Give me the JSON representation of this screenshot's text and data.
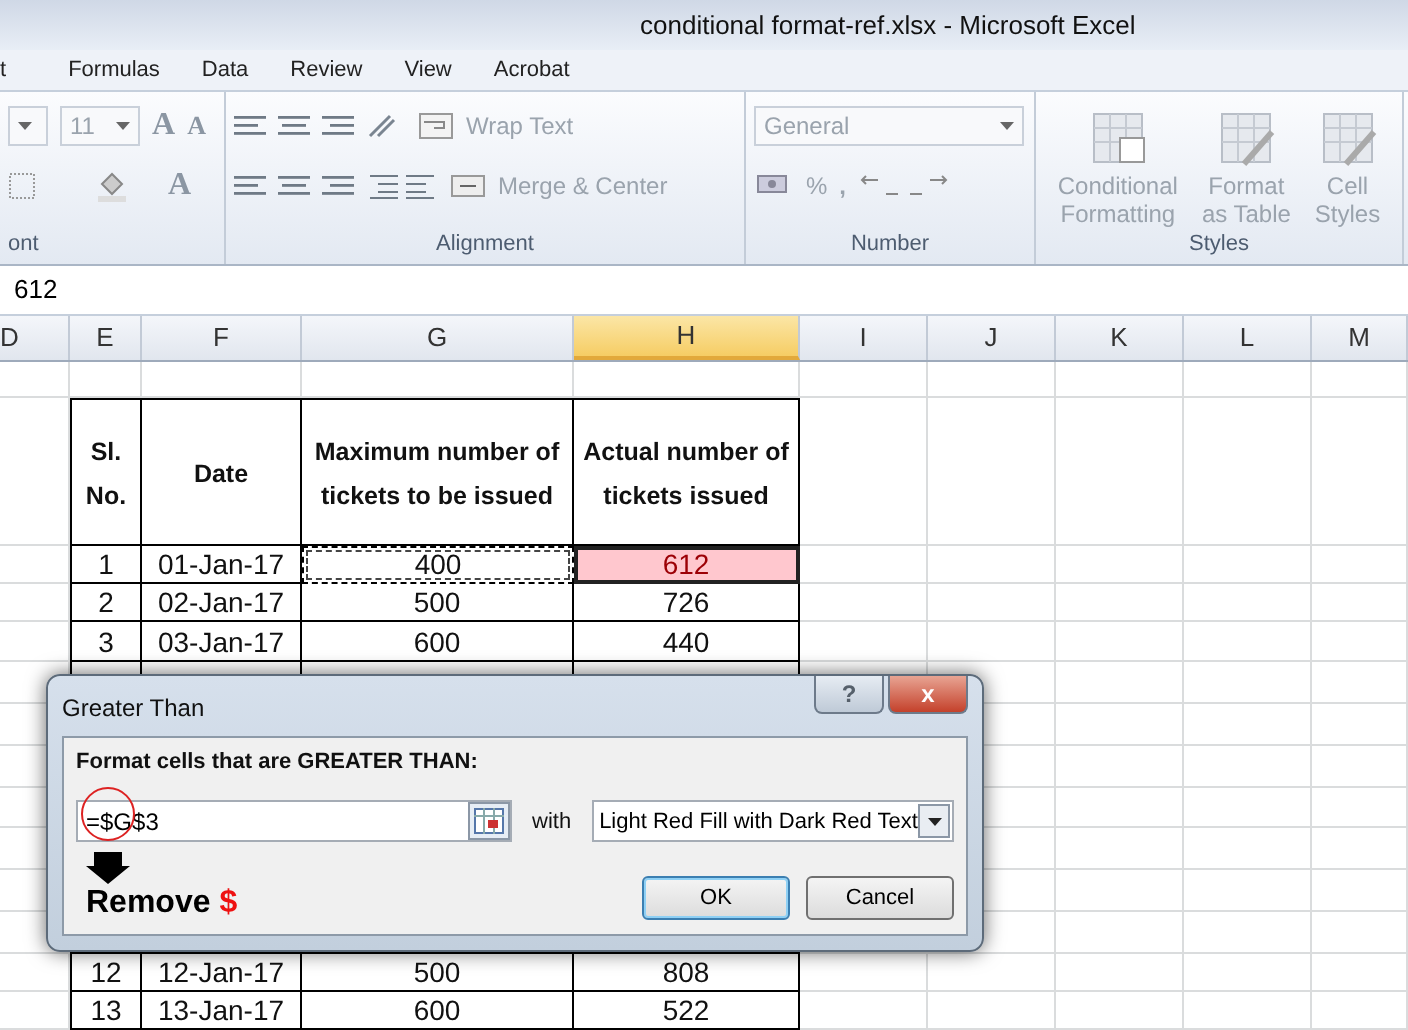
{
  "window": {
    "title": "conditional format-ref.xlsx  -  Microsoft Excel"
  },
  "ribbon_tabs": [
    {
      "label": "t"
    },
    {
      "label": "Formulas"
    },
    {
      "label": "Data"
    },
    {
      "label": "Review"
    },
    {
      "label": "View"
    },
    {
      "label": "Acrobat"
    }
  ],
  "ribbon": {
    "font": {
      "size": "11",
      "grow": "A",
      "shrink": "A",
      "font_color": "A",
      "label": "ont"
    },
    "alignment": {
      "wrap_text": "Wrap Text",
      "merge": "Merge & Center",
      "label": "Alignment"
    },
    "number": {
      "format": "General",
      "percent": "%",
      "comma": ",",
      "label": "Number"
    },
    "styles": {
      "buttons": [
        {
          "lines": [
            "Conditional",
            "Formatting"
          ]
        },
        {
          "lines": [
            "Format",
            "as Table"
          ]
        },
        {
          "lines": [
            "Cell",
            "Styles"
          ]
        }
      ],
      "label": "Styles"
    }
  },
  "formula_bar": {
    "value": "612"
  },
  "columns": [
    {
      "label": "D",
      "selected": false
    },
    {
      "label": "E",
      "selected": false
    },
    {
      "label": "F",
      "selected": false
    },
    {
      "label": "G",
      "selected": false
    },
    {
      "label": "H",
      "selected": true
    },
    {
      "label": "I",
      "selected": false
    },
    {
      "label": "J",
      "selected": false
    },
    {
      "label": "K",
      "selected": false
    },
    {
      "label": "L",
      "selected": false
    },
    {
      "label": "M",
      "selected": false
    }
  ],
  "table": {
    "headers": [
      {
        "lines": [
          "Sl.",
          "No."
        ]
      },
      {
        "lines": [
          "Date"
        ]
      },
      {
        "lines": [
          "Maximum number of",
          "tickets  to be issued"
        ]
      },
      {
        "lines": [
          "Actual number of",
          "tickets issued"
        ]
      }
    ],
    "rows_top": [
      {
        "sl": "1",
        "date": "01-Jan-17",
        "max": "400",
        "actual": "612",
        "max_copied": true,
        "actual_highlighted": true
      },
      {
        "sl": "2",
        "date": "02-Jan-17",
        "max": "500",
        "actual": "726",
        "max_copied": false,
        "actual_highlighted": false
      },
      {
        "sl": "3",
        "date": "03-Jan-17",
        "max": "600",
        "actual": "440",
        "max_copied": false,
        "actual_highlighted": false
      }
    ],
    "rows_bottom": [
      {
        "sl": "12",
        "date": "12-Jan-17",
        "max": "500",
        "actual": "808",
        "max_copied": false,
        "actual_highlighted": false
      },
      {
        "sl": "13",
        "date": "13-Jan-17",
        "max": "600",
        "actual": "522",
        "max_copied": false,
        "actual_highlighted": false
      }
    ]
  },
  "dialog": {
    "title": "Greater Than",
    "help": "?",
    "close": "x",
    "prompt": "Format cells that are GREATER THAN:",
    "value": "=$G$3",
    "with_label": "with",
    "format": "Light Red Fill with Dark Red Text",
    "buttons": [
      {
        "label": "OK",
        "default": true
      },
      {
        "label": "Cancel",
        "default": false
      }
    ],
    "annotation": {
      "text": "Remove",
      "symbol": "$"
    }
  }
}
